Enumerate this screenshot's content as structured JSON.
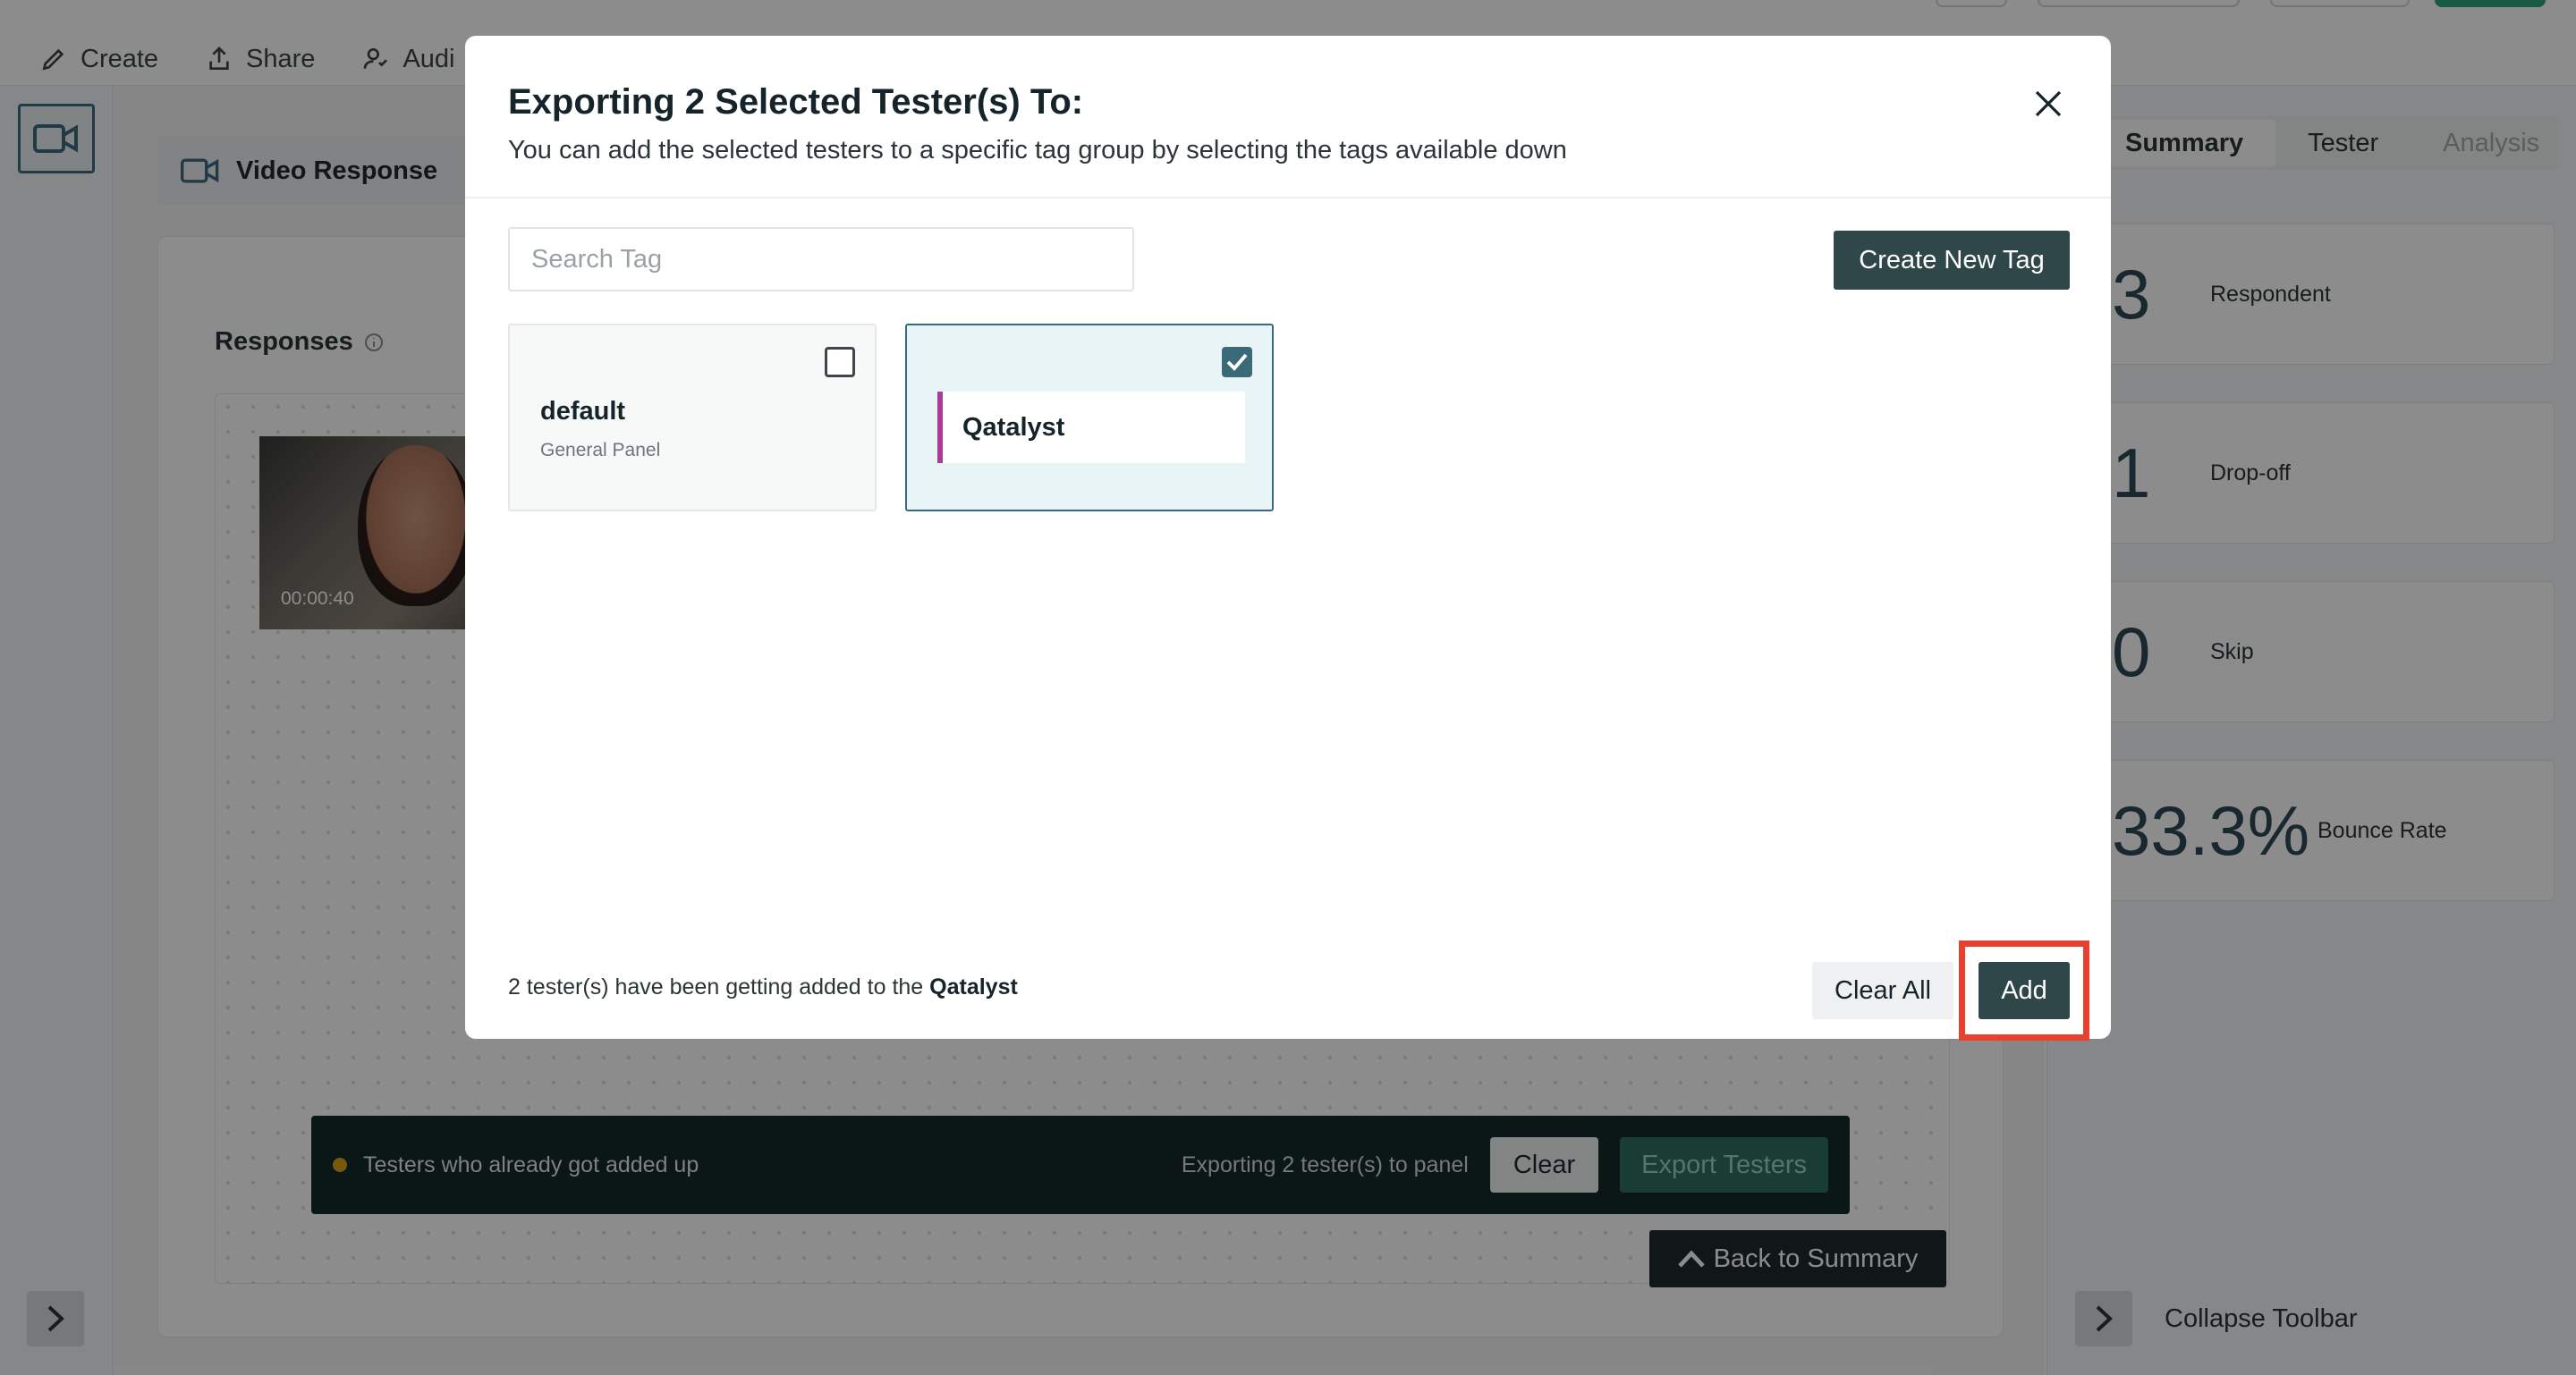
{
  "topnav": {
    "create": "Create",
    "share": "Share",
    "audience": "Audi"
  },
  "question": {
    "title": "Video Response"
  },
  "responses": {
    "label": "Responses",
    "video_time": "00:00:40"
  },
  "right_panel": {
    "tabs": [
      {
        "label": "Summary"
      },
      {
        "label": "Tester"
      },
      {
        "label": "Analysis"
      }
    ],
    "stats": [
      {
        "value": "3",
        "label": "Respondent"
      },
      {
        "value": "1",
        "label": "Drop-off"
      },
      {
        "value": "0",
        "label": "Skip"
      },
      {
        "value": "33.3%",
        "label": "Bounce Rate"
      }
    ],
    "collapse_label": "Collapse Toolbar"
  },
  "export_bar": {
    "message": "Testers who already got added up",
    "exporting": "Exporting 2 tester(s) to panel",
    "clear": "Clear",
    "export": "Export Testers"
  },
  "back_button": "Back to Summary",
  "modal": {
    "title": "Exporting 2 Selected Tester(s) To:",
    "subtitle": "You can add the selected testers to a specific tag group by selecting the tags available down",
    "search_placeholder": "Search Tag",
    "create_button": "Create New Tag",
    "tags": [
      {
        "name": "default",
        "desc": "General Panel",
        "checked": false
      },
      {
        "name": "Qatalyst",
        "checked": true
      }
    ],
    "footer_prefix": "2 tester(s) have been getting added to the ",
    "footer_tag": "Qatalyst",
    "clear_all": "Clear All",
    "add": "Add"
  },
  "colors": {
    "accent": "#2f4748",
    "selected_border": "#3a6a78",
    "tag_stripe": "#a83d97",
    "highlight": "#e8402f"
  }
}
